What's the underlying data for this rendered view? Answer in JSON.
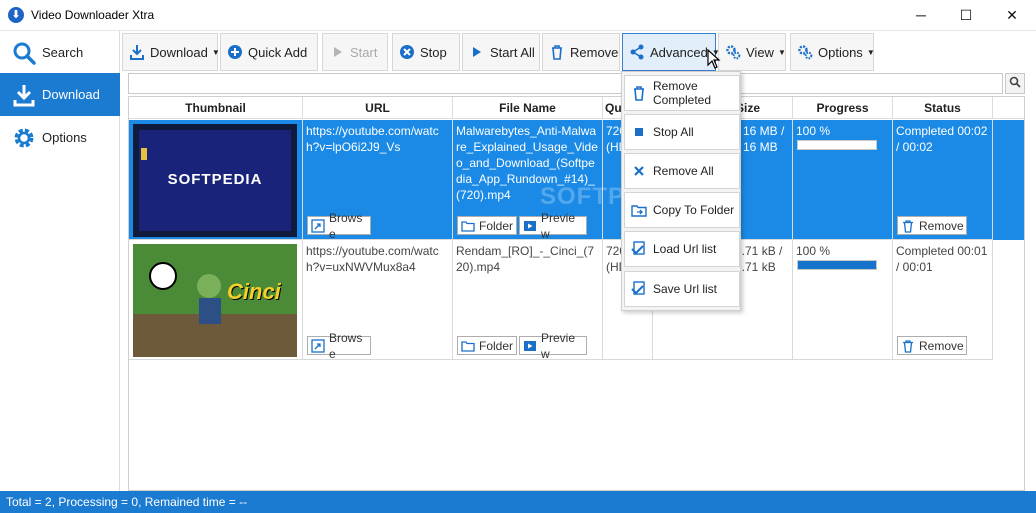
{
  "window": {
    "title": "Video Downloader Xtra",
    "minimize": "─",
    "maximize": "☐",
    "close": "✕"
  },
  "sidebar": {
    "items": [
      {
        "label": "Search",
        "icon": "search-icon"
      },
      {
        "label": "Download",
        "icon": "download-icon"
      },
      {
        "label": "Options",
        "icon": "gear-icon"
      }
    ]
  },
  "toolbar": {
    "download": "Download",
    "quick_add": "Quick Add",
    "start": "Start",
    "stop": "Stop",
    "start_all": "Start All",
    "remove": "Remove",
    "advanced": "Advanced",
    "view": "View",
    "options": "Options"
  },
  "search": {
    "placeholder": ""
  },
  "columns": [
    "Thumbnail",
    "URL",
    "File Name",
    "Qu",
    "Size",
    "Progress",
    "Status"
  ],
  "rows": [
    {
      "url": "https://youtube.com/watch?v=lpO6i2J9_Vs",
      "file_name": "Malwarebytes_Anti-Malware_Explained_Usage_Video_and_Download_(Softpedia_App_Rundown_#14)_(720).mp4",
      "quality": "720 (HD",
      "size": "16 MB / 16 MB",
      "progress_text": "100 %",
      "progress": 100,
      "status": "Completed 00:02 / 00:02",
      "thumb_text": "SOFTPEDIA"
    },
    {
      "url": "https://youtube.com/watch?v=uxNWVMux8a4",
      "file_name": "Rendam_[RO]_-_Cinci_(720).mp4",
      "quality": "720 (HD",
      "size": "9.71 kB / 9.71 kB",
      "progress_text": "100 %",
      "progress": 100,
      "status": "Completed 00:01 / 00:01",
      "thumb_text": "Cinci"
    }
  ],
  "cell_buttons": {
    "browse": "Browse",
    "folder": "Folder",
    "preview": "Preview",
    "remove": "Remove"
  },
  "advanced_menu": [
    "Remove Completed",
    "Stop All",
    "Remove All",
    "Copy To Folder",
    "Load Url list",
    "Save Url list"
  ],
  "status": "Total = 2, Processing = 0, Remained time = --",
  "watermark": "SOFTPEDIA",
  "colors": {
    "accent": "#1a7bd0",
    "selected_row": "#1a8ae6"
  }
}
